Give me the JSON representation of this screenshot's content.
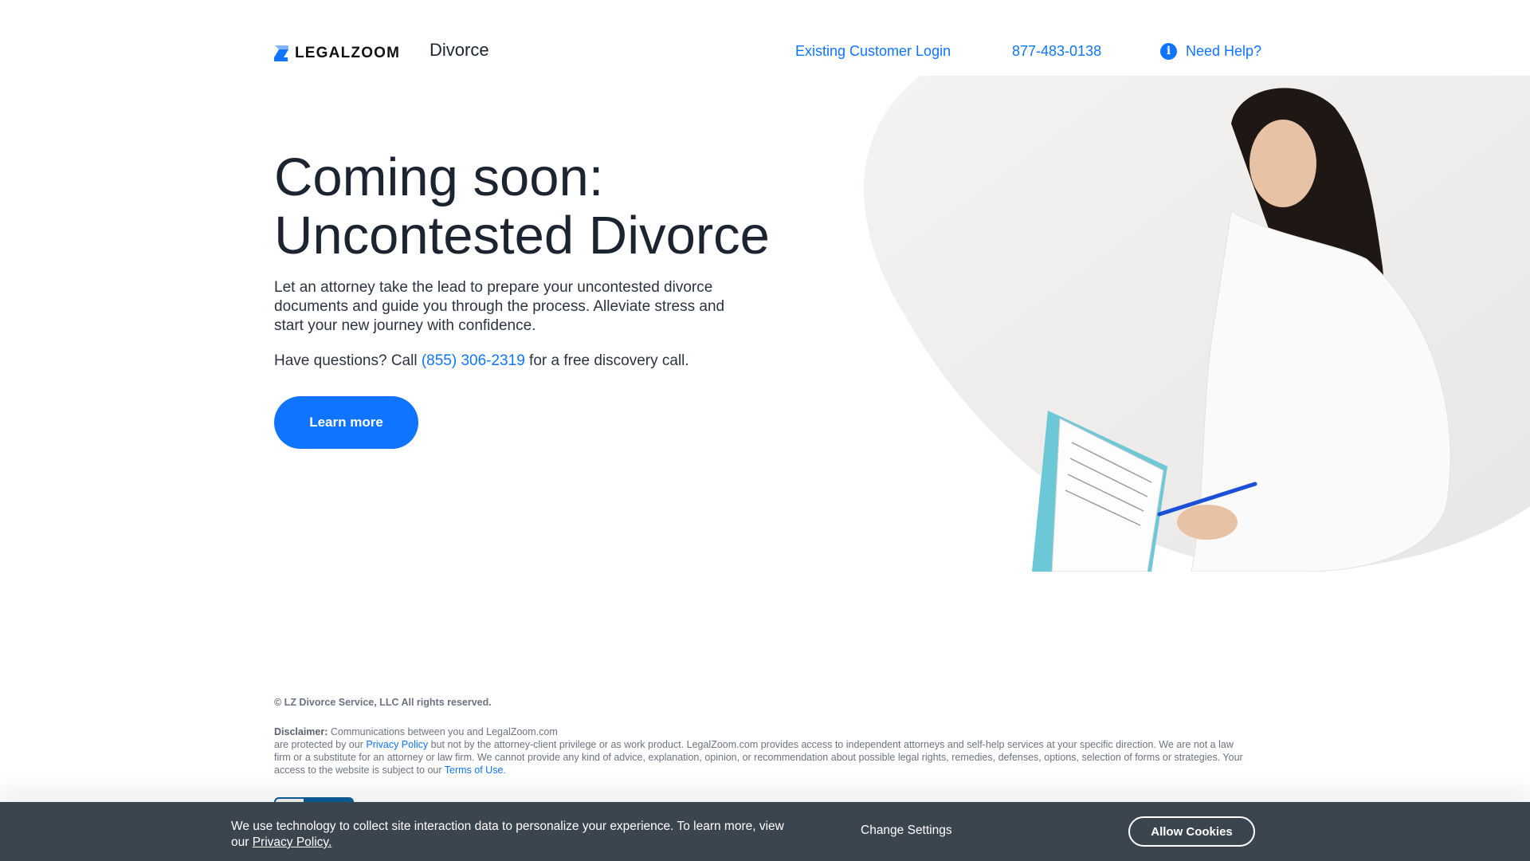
{
  "header": {
    "logo_text": "LEGALZOOM",
    "section": "Divorce",
    "links": [
      {
        "label": "Existing Customer Login"
      },
      {
        "label": "877-483-0138"
      },
      {
        "label": "Need Help?",
        "icon": "info-icon"
      }
    ]
  },
  "hero": {
    "headline_line1": "Coming soon:",
    "headline_line2": "Uncontested Divorce",
    "intro": "Let an attorney take the lead to prepare your uncontested divorce documents and guide you through the process. Alleviate stress and start your new journey with confidence.",
    "questions_prefix": "Have questions? Call ",
    "questions_phone": "(855) 306-2319",
    "questions_suffix": " for a free discovery call.",
    "cta_label": "Learn more"
  },
  "footer": {
    "copyright": "© LZ Divorce Service, LLC All rights reserved.",
    "disclaimer_label": "Disclaimer:",
    "disclaimer_line1": " Communications between you and LegalZoom.com",
    "disclaimer_part2": "are protected by our ",
    "privacy_link": "Privacy Policy",
    "disclaimer_part3": " but not by the attorney-client privilege or as work product. LegalZoom.com provides access to independent attorneys and self-help services at your specific direction. We are not a law firm or a substitute for an attorney or law firm. We cannot provide any kind of advice, explanation, opinion, or recommendation about possible legal rights, remedies, defenses, options, selection of forms or strategies. Your access to the website is subject to our ",
    "terms_link": "Terms of Use",
    "disclaimer_end": "."
  },
  "cookie_banner": {
    "text": "We use technology to collect site interaction data to personalize your experience. To learn more, view our ",
    "privacy_link": "Privacy Policy.",
    "change_settings": "Change Settings",
    "allow_cookies": "Allow Cookies"
  },
  "colors": {
    "accent": "#0f74ff",
    "text": "#1c2431",
    "cookie_bar": "#3b4550",
    "muted": "#6b7280"
  }
}
